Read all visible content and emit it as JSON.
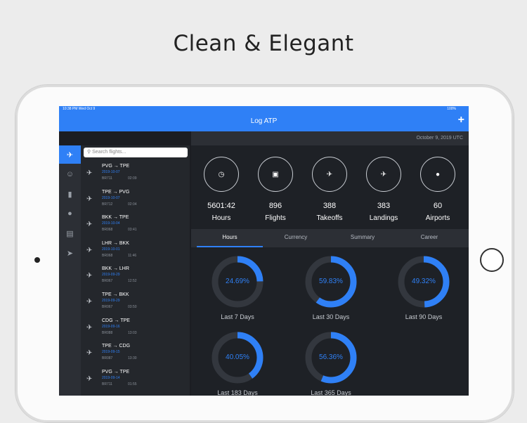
{
  "headline": "Clean & Elegant",
  "status_bar": {
    "time": "10:38 PM  Wed Oct 9",
    "battery": "100%"
  },
  "nav": {
    "title": "Log ATP",
    "add_icon": "plus-icon"
  },
  "date_utc": "October 9, 2019 UTC",
  "search": {
    "placeholder": "Search flights..."
  },
  "rail_icons": [
    "airplane-icon",
    "pilot-icon",
    "bar-chart-icon",
    "globe-icon",
    "document-icon",
    "send-icon"
  ],
  "flights": [
    {
      "route": "PVG → TPE",
      "date": "2019-10-07",
      "flight": "BR711",
      "duration": "02:09"
    },
    {
      "route": "TPE → PVG",
      "date": "2019-10-07",
      "flight": "BR712",
      "duration": "02:04"
    },
    {
      "route": "BKK → TPE",
      "date": "2019-10-04",
      "flight": "BR068",
      "duration": "03:41"
    },
    {
      "route": "LHR → BKK",
      "date": "2019-10-01",
      "flight": "BR068",
      "duration": "11:46"
    },
    {
      "route": "BKK → LHR",
      "date": "2019-09-29",
      "flight": "BR067",
      "duration": "12:52"
    },
    {
      "route": "TPE → BKK",
      "date": "2019-09-29",
      "flight": "BR067",
      "duration": "03:50"
    },
    {
      "route": "CDG → TPE",
      "date": "2019-09-16",
      "flight": "BR088",
      "duration": "13:03"
    },
    {
      "route": "TPE → CDG",
      "date": "2019-09-15",
      "flight": "BR087",
      "duration": "13:30"
    },
    {
      "route": "PVG → TPE",
      "date": "2019-09-14",
      "flight": "BR711",
      "duration": "01:55"
    }
  ],
  "stats": [
    {
      "value": "5601:42",
      "label": "Hours",
      "icon": "clock-icon"
    },
    {
      "value": "896",
      "label": "Flights",
      "icon": "briefcase-icon"
    },
    {
      "value": "388",
      "label": "Takeoffs",
      "icon": "takeoff-icon"
    },
    {
      "value": "383",
      "label": "Landings",
      "icon": "landing-icon"
    },
    {
      "value": "60",
      "label": "Airports",
      "icon": "location-pin-icon"
    }
  ],
  "tabs": [
    "Hours",
    "Currency",
    "Summary",
    "Career"
  ],
  "active_tab": "Hours",
  "rings": [
    {
      "percent": 24.69,
      "text": "24.69%",
      "label": "Last 7 Days"
    },
    {
      "percent": 59.83,
      "text": "59.83%",
      "label": "Last 30 Days"
    },
    {
      "percent": 49.32,
      "text": "49.32%",
      "label": "Last 90 Days"
    },
    {
      "percent": 40.05,
      "text": "40.05%",
      "label": "Last 183 Days"
    },
    {
      "percent": 56.36,
      "text": "56.36%",
      "label": "Last 365 Days"
    }
  ],
  "colors": {
    "accent": "#2f80f6",
    "track": "#33373e",
    "background": "#1e2126"
  }
}
